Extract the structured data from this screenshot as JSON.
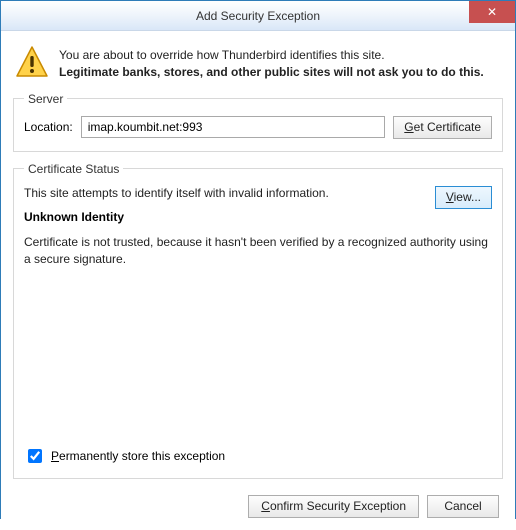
{
  "window": {
    "title": "Add Security Exception",
    "close_glyph": "✕"
  },
  "warning": {
    "line1": "You are about to override how Thunderbird identifies this site.",
    "line2": "Legitimate banks, stores, and other public sites will not ask you to do this."
  },
  "server": {
    "legend": "Server",
    "location_label": "Location:",
    "location_value": "imap.koumbit.net:993",
    "get_cert_underline": "G",
    "get_cert_rest": "et Certificate"
  },
  "cert": {
    "legend": "Certificate Status",
    "desc": "This site attempts to identify itself with invalid information.",
    "heading": "Unknown Identity",
    "body": "Certificate is not trusted, because it hasn't been verified by a recognized authority using a secure signature.",
    "view_underline": "V",
    "view_rest": "iew..."
  },
  "perm": {
    "label_underline": "P",
    "label_rest": "ermanently store this exception",
    "checked": true
  },
  "footer": {
    "confirm_underline": "C",
    "confirm_rest": "onfirm Security Exception",
    "cancel": "Cancel"
  }
}
